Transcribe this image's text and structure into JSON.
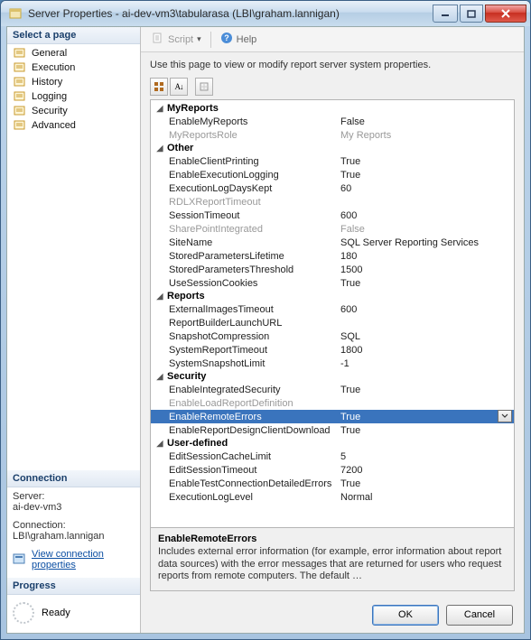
{
  "window": {
    "title": "Server Properties - ai-dev-vm3\\tabularasa (LBI\\graham.lannigan)"
  },
  "sidebar": {
    "selectHeader": "Select a page",
    "pages": [
      {
        "label": "General"
      },
      {
        "label": "Execution"
      },
      {
        "label": "History"
      },
      {
        "label": "Logging"
      },
      {
        "label": "Security"
      },
      {
        "label": "Advanced"
      }
    ],
    "connection": {
      "header": "Connection",
      "serverLabel": "Server:",
      "server": "ai-dev-vm3",
      "connLabel": "Connection:",
      "conn": "LBI\\graham.lannigan",
      "viewLink": "View connection properties"
    },
    "progress": {
      "header": "Progress",
      "status": "Ready"
    }
  },
  "toolbar": {
    "script": "Script",
    "help": "Help"
  },
  "intro": "Use this page to view or modify report server system properties.",
  "grid": {
    "groups": [
      {
        "name": "MyReports",
        "rows": [
          {
            "n": "EnableMyReports",
            "v": "False"
          },
          {
            "n": "MyReportsRole",
            "v": "My Reports",
            "gray": true
          }
        ]
      },
      {
        "name": "Other",
        "rows": [
          {
            "n": "EnableClientPrinting",
            "v": "True"
          },
          {
            "n": "EnableExecutionLogging",
            "v": "True"
          },
          {
            "n": "ExecutionLogDaysKept",
            "v": "60"
          },
          {
            "n": "RDLXReportTimeout",
            "v": "",
            "gray": true
          },
          {
            "n": "SessionTimeout",
            "v": "600"
          },
          {
            "n": "SharePointIntegrated",
            "v": "False",
            "gray": true
          },
          {
            "n": "SiteName",
            "v": "SQL Server Reporting Services"
          },
          {
            "n": "StoredParametersLifetime",
            "v": "180"
          },
          {
            "n": "StoredParametersThreshold",
            "v": "1500"
          },
          {
            "n": "UseSessionCookies",
            "v": "True"
          }
        ]
      },
      {
        "name": "Reports",
        "rows": [
          {
            "n": "ExternalImagesTimeout",
            "v": "600"
          },
          {
            "n": "ReportBuilderLaunchURL",
            "v": ""
          },
          {
            "n": "SnapshotCompression",
            "v": "SQL"
          },
          {
            "n": "SystemReportTimeout",
            "v": "1800"
          },
          {
            "n": "SystemSnapshotLimit",
            "v": "-1"
          }
        ]
      },
      {
        "name": "Security",
        "rows": [
          {
            "n": "EnableIntegratedSecurity",
            "v": "True"
          },
          {
            "n": "EnableLoadReportDefinition",
            "v": "",
            "gray": true
          },
          {
            "n": "EnableRemoteErrors",
            "v": "True",
            "selected": true
          },
          {
            "n": "EnableReportDesignClientDownload",
            "v": "True"
          }
        ]
      },
      {
        "name": "User-defined",
        "rows": [
          {
            "n": "EditSessionCacheLimit",
            "v": "5"
          },
          {
            "n": "EditSessionTimeout",
            "v": "7200"
          },
          {
            "n": "EnableTestConnectionDetailedErrors",
            "v": "True"
          },
          {
            "n": "ExecutionLogLevel",
            "v": "Normal"
          }
        ]
      }
    ]
  },
  "description": {
    "title": "EnableRemoteErrors",
    "body": "Includes external error information (for example, error information about report data sources) with the error messages that are returned for users who request reports from remote computers. The default …"
  },
  "buttons": {
    "ok": "OK",
    "cancel": "Cancel"
  }
}
